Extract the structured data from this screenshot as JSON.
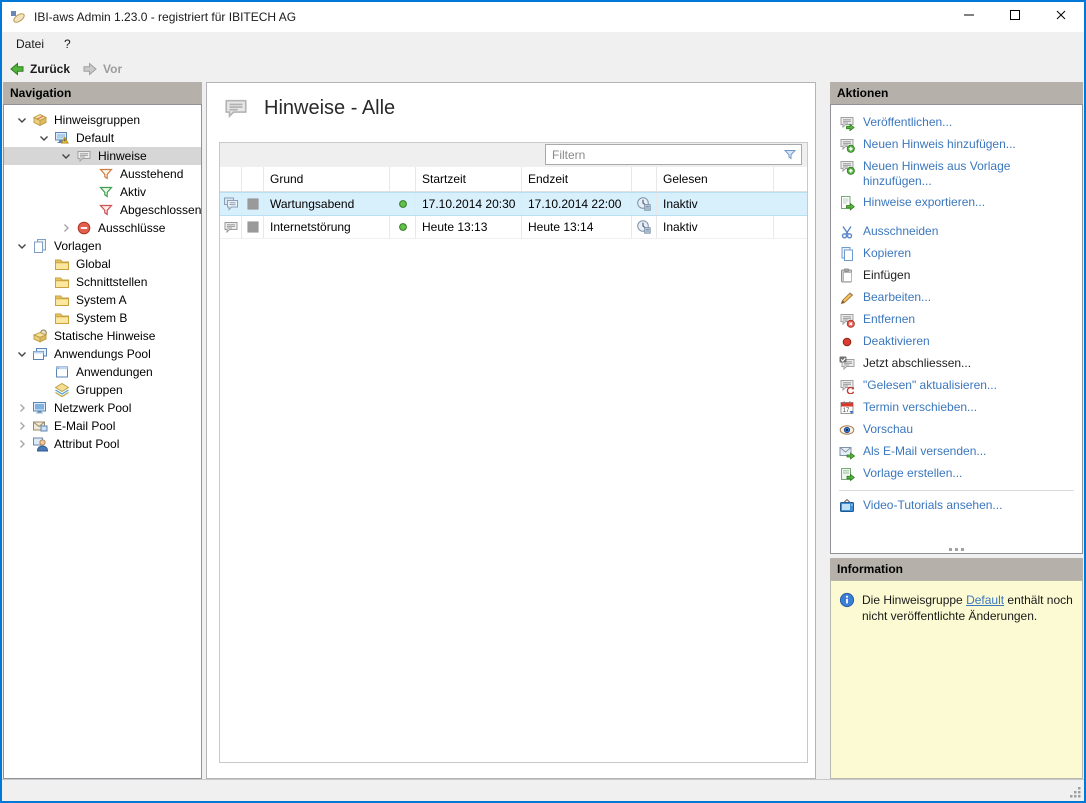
{
  "window": {
    "title": "IBI-aws Admin 1.23.0 - registriert für IBITECH AG",
    "app_icon": "app",
    "controls": [
      "minimize",
      "maximize",
      "close"
    ]
  },
  "menu": {
    "items": [
      {
        "label": "Datei"
      },
      {
        "label": "?"
      }
    ]
  },
  "toolbar": {
    "back": "Zurück",
    "forward": "Vor"
  },
  "navigation": {
    "header": "Navigation",
    "tree": [
      {
        "label": "Hinweisgruppen",
        "level": 0,
        "chevron": "down",
        "icon": "boxstack"
      },
      {
        "label": "Default",
        "level": 1,
        "chevron": "down",
        "icon": "monwarn"
      },
      {
        "label": "Hinweise",
        "level": 2,
        "chevron": "down",
        "icon": "speech",
        "selected": true
      },
      {
        "label": "Ausstehend",
        "level": 3,
        "chevron": null,
        "icon": "funnel-orange"
      },
      {
        "label": "Aktiv",
        "level": 3,
        "chevron": null,
        "icon": "funnel-green"
      },
      {
        "label": "Abgeschlossen",
        "level": 3,
        "chevron": null,
        "icon": "funnel-red"
      },
      {
        "label": "Ausschlüsse",
        "level": 2,
        "chevron": "right",
        "icon": "minuscircle"
      },
      {
        "label": "Vorlagen",
        "level": 0,
        "chevron": "down",
        "icon": "docs"
      },
      {
        "label": "Global",
        "level": 1,
        "chevron": null,
        "icon": "folder"
      },
      {
        "label": "Schnittstellen",
        "level": 1,
        "chevron": null,
        "icon": "folder"
      },
      {
        "label": "System A",
        "level": 1,
        "chevron": null,
        "icon": "folder"
      },
      {
        "label": "System B",
        "level": 1,
        "chevron": null,
        "icon": "folder"
      },
      {
        "label": "Statische Hinweise",
        "level": 0,
        "chevron": null,
        "icon": "staticbox"
      },
      {
        "label": "Anwendungs Pool",
        "level": 0,
        "chevron": "down",
        "icon": "windows2"
      },
      {
        "label": "Anwendungen",
        "level": 1,
        "chevron": null,
        "icon": "window1"
      },
      {
        "label": "Gruppen",
        "level": 1,
        "chevron": null,
        "icon": "diamond"
      },
      {
        "label": "Netzwerk Pool",
        "level": 0,
        "chevron": "right",
        "icon": "monitor"
      },
      {
        "label": "E-Mail Pool",
        "level": 0,
        "chevron": "right",
        "icon": "mailpool"
      },
      {
        "label": "Attribut Pool",
        "level": 0,
        "chevron": "right",
        "icon": "userpc"
      }
    ]
  },
  "main": {
    "title": "Hinweise - Alle",
    "title_icon": "speechlg",
    "filter": {
      "placeholder": "Filtern",
      "icon": "filterfunnel"
    },
    "table": {
      "columns": [
        "",
        "",
        "Grund",
        "",
        "Startzeit",
        "Endzeit",
        "",
        "Gelesen"
      ],
      "rows": [
        {
          "row_icon": "speech2",
          "thumb": "graysq",
          "grund": "Wartungsabend",
          "status_icon": "greendot",
          "startzeit": "17.10.2014 20:30",
          "endzeit": "17.10.2014 22:00",
          "gelesen_icon": "clockh",
          "gelesen": "Inaktiv",
          "selected": true
        },
        {
          "row_icon": "speech1",
          "thumb": "graysq",
          "grund": "Internetstörung",
          "status_icon": "greendot",
          "startzeit": "Heute 13:13",
          "endzeit": "Heute 13:14",
          "gelesen_icon": "clockh",
          "gelesen": "Inaktiv",
          "selected": false
        }
      ]
    }
  },
  "actions": {
    "header": "Aktionen",
    "items": [
      {
        "label": "Veröffentlichen...",
        "icon": "speecharrow",
        "enabled": true
      },
      {
        "label": "Neuen Hinweis hinzufügen...",
        "icon": "speechplus",
        "enabled": true
      },
      {
        "label": "Neuen Hinweis aus Vorlage hinzufügen...",
        "icon": "speechplus",
        "enabled": true
      },
      {
        "label": "Hinweise exportieren...",
        "icon": "pageexport",
        "enabled": true,
        "gap_after": true
      },
      {
        "label": "Ausschneiden",
        "icon": "scissors",
        "enabled": true
      },
      {
        "label": "Kopieren",
        "icon": "copy",
        "enabled": true
      },
      {
        "label": "Einfügen",
        "icon": "paste",
        "enabled": false
      },
      {
        "label": "Bearbeiten...",
        "icon": "pencil",
        "enabled": true
      },
      {
        "label": "Entfernen",
        "icon": "speechremove",
        "enabled": true
      },
      {
        "label": "Deaktivieren",
        "icon": "reddot",
        "enabled": true
      },
      {
        "label": "Jetzt abschliessen...",
        "icon": "speechcheck",
        "enabled": false
      },
      {
        "label": "\"Gelesen\" aktualisieren...",
        "icon": "speechrefresh",
        "enabled": true
      },
      {
        "label": "Termin verschieben...",
        "icon": "calendar",
        "enabled": true
      },
      {
        "label": "Vorschau",
        "icon": "eye",
        "enabled": true
      },
      {
        "label": "Als E-Mail versenden...",
        "icon": "mailfwd",
        "enabled": true
      },
      {
        "label": "Vorlage erstellen...",
        "icon": "pagetmpl",
        "enabled": true
      },
      {
        "label": "Video-Tutorials ansehen...",
        "icon": "tv",
        "enabled": true,
        "separator_before": true
      }
    ]
  },
  "information": {
    "header": "Information",
    "icon": "infoicon",
    "text_before": "Die Hinweisgruppe ",
    "link": "Default",
    "text_after": " enthält noch nicht veröffentlichte Änderungen."
  },
  "colors": {
    "accent": "#0078d7",
    "link_blue": "#3b77bd",
    "panel_header_bg": "#b5b1aa",
    "selection_blue": "#d8effc",
    "tree_selection": "#d6d6d6",
    "info_bg": "#fbfad2",
    "disabled_text": "#1e1e1e",
    "status_green": "#63c04e"
  }
}
